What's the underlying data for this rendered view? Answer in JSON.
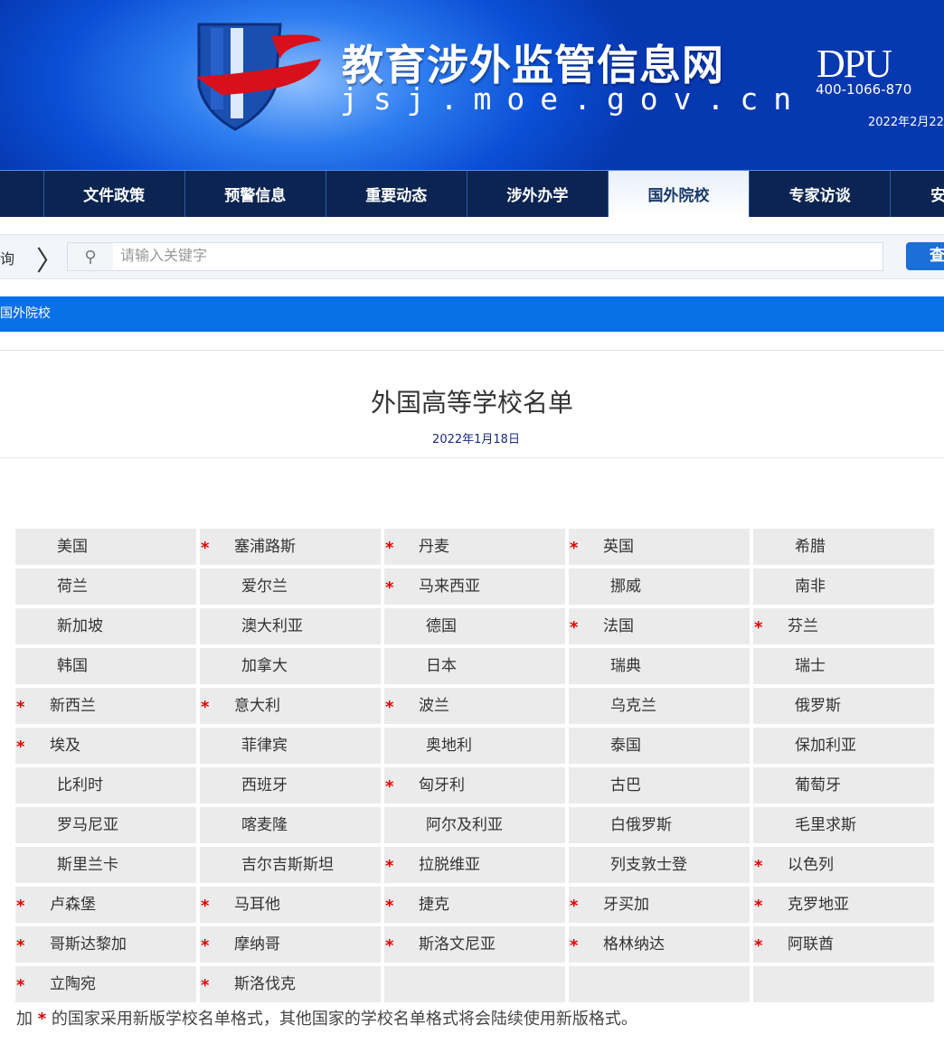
{
  "header": {
    "site_title": "教育涉外监管信息网",
    "site_url": "jsj.moe.gov.cn",
    "partner_logo": "DPU",
    "phone": "400-1066-870",
    "date": "2022年2月22"
  },
  "nav": {
    "items": [
      "",
      "文件政策",
      "预警信息",
      "重要动态",
      "涉外办学",
      "国外院校",
      "专家访谈",
      "安"
    ],
    "active": "国外院校"
  },
  "search": {
    "label": "询",
    "placeholder": "请输入关键字",
    "value": "",
    "button": "查"
  },
  "breadcrumb": "国外院校",
  "article": {
    "title": "外国高等学校名单",
    "date": "2022年1月18日"
  },
  "colors": {
    "star": "#e00000",
    "nav_bg": "#0b2451",
    "breadcrumb_bg": "#0a70e6"
  },
  "countries": [
    [
      [
        "美国",
        false
      ],
      [
        "塞浦路斯",
        true
      ],
      [
        "丹麦",
        true
      ],
      [
        "英国",
        true
      ],
      [
        "希腊",
        false
      ]
    ],
    [
      [
        "荷兰",
        false
      ],
      [
        "爱尔兰",
        false
      ],
      [
        "马来西亚",
        true
      ],
      [
        "挪威",
        false
      ],
      [
        "南非",
        false
      ]
    ],
    [
      [
        "新加坡",
        false
      ],
      [
        "澳大利亚",
        false
      ],
      [
        "德国",
        false
      ],
      [
        "法国",
        true
      ],
      [
        "芬兰",
        true
      ]
    ],
    [
      [
        "韩国",
        false
      ],
      [
        "加拿大",
        false
      ],
      [
        "日本",
        false
      ],
      [
        "瑞典",
        false
      ],
      [
        "瑞士",
        false
      ]
    ],
    [
      [
        "新西兰",
        true
      ],
      [
        "意大利",
        true
      ],
      [
        "波兰",
        true
      ],
      [
        "乌克兰",
        false
      ],
      [
        "俄罗斯",
        false
      ]
    ],
    [
      [
        "埃及",
        true
      ],
      [
        "菲律宾",
        false
      ],
      [
        "奥地利",
        false
      ],
      [
        "泰国",
        false
      ],
      [
        "保加利亚",
        false
      ]
    ],
    [
      [
        "比利时",
        false
      ],
      [
        "西班牙",
        false
      ],
      [
        "匈牙利",
        true
      ],
      [
        "古巴",
        false
      ],
      [
        "葡萄牙",
        false
      ]
    ],
    [
      [
        "罗马尼亚",
        false
      ],
      [
        "喀麦隆",
        false
      ],
      [
        "阿尔及利亚",
        false
      ],
      [
        "白俄罗斯",
        false
      ],
      [
        "毛里求斯",
        false
      ]
    ],
    [
      [
        "斯里兰卡",
        false
      ],
      [
        "吉尔吉斯斯坦",
        false
      ],
      [
        "拉脱维亚",
        true
      ],
      [
        "列支敦士登",
        false
      ],
      [
        "以色列",
        true
      ]
    ],
    [
      [
        "卢森堡",
        true
      ],
      [
        "马耳他",
        true
      ],
      [
        "捷克",
        true
      ],
      [
        "牙买加",
        true
      ],
      [
        "克罗地亚",
        true
      ]
    ],
    [
      [
        "哥斯达黎加",
        true
      ],
      [
        "摩纳哥",
        true
      ],
      [
        "斯洛文尼亚",
        true
      ],
      [
        "格林纳达",
        true
      ],
      [
        "阿联酋",
        true
      ]
    ],
    [
      [
        "立陶宛",
        true
      ],
      [
        "斯洛伐克",
        true
      ],
      [
        "",
        false
      ],
      [
        "",
        false
      ],
      [
        "",
        false
      ]
    ]
  ],
  "star_symbol": "*",
  "note": {
    "prefix": "加",
    "star": "*",
    "text": "的国家采用新版学校名单格式，其他国家的学校名单格式将会陆续使用新版格式。"
  }
}
